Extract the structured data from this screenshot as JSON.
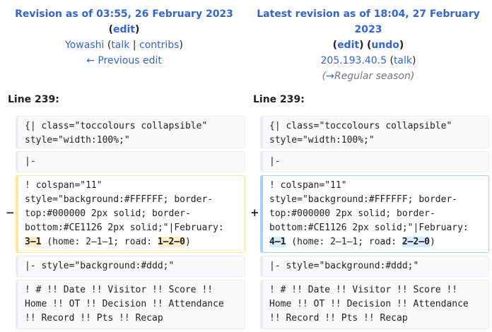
{
  "old_rev": {
    "title": "Revision as of 03:55, 26 February 2023",
    "edit": "edit",
    "user": "Yowashi",
    "talk": "talk",
    "contribs": "contribs",
    "prev_edit": "← Previous edit"
  },
  "new_rev": {
    "title": "Latest revision as of 18:04, 27 February 2023",
    "edit": "edit",
    "undo": "undo",
    "user": "205.193.40.5",
    "talk": "talk",
    "summary_arrow": "→",
    "summary_section": "Regular season"
  },
  "line_numbers": {
    "left": "Line 239:",
    "right": "Line 239:"
  },
  "markers": {
    "del": "−",
    "add": "+"
  },
  "rows": {
    "r1": "{| class=\"toccolours collapsible\" style=\"width:100%;\"",
    "r2": "|-",
    "r3_prefix": "! colspan=\"11\" style=\"background:#FFFFFF; border-top:#000000 2px solid; border-bottom:#CE1126 2px solid;\"|February: ",
    "r3_left_hl1": "3–1",
    "r3_mid": " (home: 2–1–1; road: ",
    "r3_left_hl2": "1–2–0",
    "r3_right_hl1": "4–1",
    "r3_right_hl2": "2–2–0",
    "r3_suffix": ")",
    "r4": "|- style=\"background:#ddd;\"",
    "r5": "! # !! Date !! Visitor !! Score !! Home !! OT !! Decision !! Attendance !! Record !! Pts !! Recap"
  }
}
